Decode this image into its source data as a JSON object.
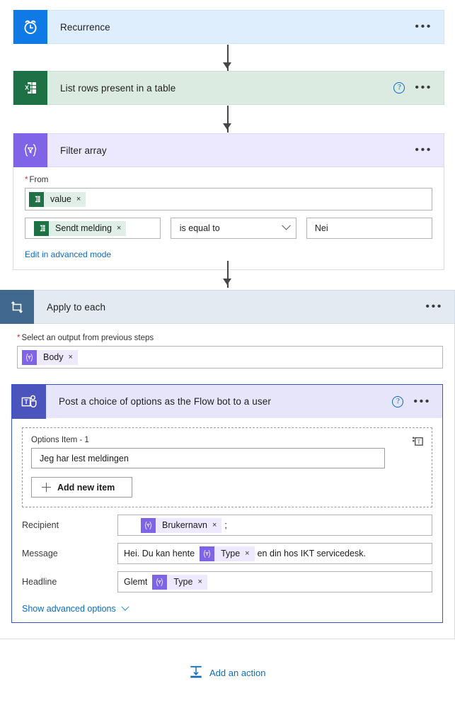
{
  "flow": {
    "steps": [
      {
        "id": "recurrence",
        "title": "Recurrence",
        "icon": "alarm-clock-icon",
        "accent": "#0f7ae5",
        "header_bg": "#dfeefc",
        "has_help": false
      },
      {
        "id": "excel",
        "title": "List rows present in a table",
        "icon": "excel-icon",
        "accent": "#1e7145",
        "header_bg": "#dcebe1",
        "has_help": true
      },
      {
        "id": "filter",
        "title": "Filter array",
        "icon": "filter-expression-icon",
        "accent": "#8064e8",
        "header_bg": "#ece8fd",
        "has_help": false
      }
    ],
    "more_label": "•••",
    "help_label": "?"
  },
  "filter_array": {
    "from_label": "From",
    "required_marker": "*",
    "from_token": {
      "text": "value",
      "icon": "excel-icon",
      "remove": "×"
    },
    "condition": {
      "left_token": {
        "text": "Sendt melding",
        "icon": "excel-icon",
        "remove": "×"
      },
      "operator": "is equal to",
      "value": "Nei"
    },
    "advanced_link": "Edit in advanced mode"
  },
  "apply_to_each": {
    "title": "Apply to each",
    "icon": "loop-icon",
    "accent": "#41688f",
    "header_bg": "#e4eaf2",
    "select_label": "Select an output from previous steps",
    "required_marker": "*",
    "body_token": {
      "text": "Body",
      "icon": "expression-icon",
      "remove": "×"
    }
  },
  "teams_action": {
    "title": "Post a choice of options as the Flow bot to a user",
    "icon": "microsoft-teams-icon",
    "accent": "#4b53bc",
    "header_bg": "#e6e5fa",
    "border_color": "#3a52c8",
    "has_help": true,
    "options": {
      "item_label": "Options Item - 1",
      "item_value": "Jeg har lest meldingen",
      "add_item_label": "Add new item",
      "dynamic_icon": "text-box-icon"
    },
    "fields": [
      {
        "label": "Recipient",
        "parts": [
          {
            "kind": "token",
            "text": "Brukernavn",
            "icon": "expression-icon",
            "remove": "×"
          },
          {
            "kind": "text",
            "text": ";"
          }
        ]
      },
      {
        "label": "Message",
        "parts": [
          {
            "kind": "text",
            "text": "Hei. Du kan hente"
          },
          {
            "kind": "token",
            "text": "Type",
            "icon": "expression-icon",
            "remove": "×"
          },
          {
            "kind": "text",
            "text": "en din hos IKT servicedesk."
          }
        ]
      },
      {
        "label": "Headline",
        "parts": [
          {
            "kind": "text",
            "text": "Glemt"
          },
          {
            "kind": "token",
            "text": "Type",
            "icon": "expression-icon",
            "remove": "×"
          }
        ]
      }
    ],
    "advanced_label": "Show advanced options"
  },
  "footer": {
    "add_action_label": "Add an action",
    "add_action_icon": "insert-below-icon"
  }
}
